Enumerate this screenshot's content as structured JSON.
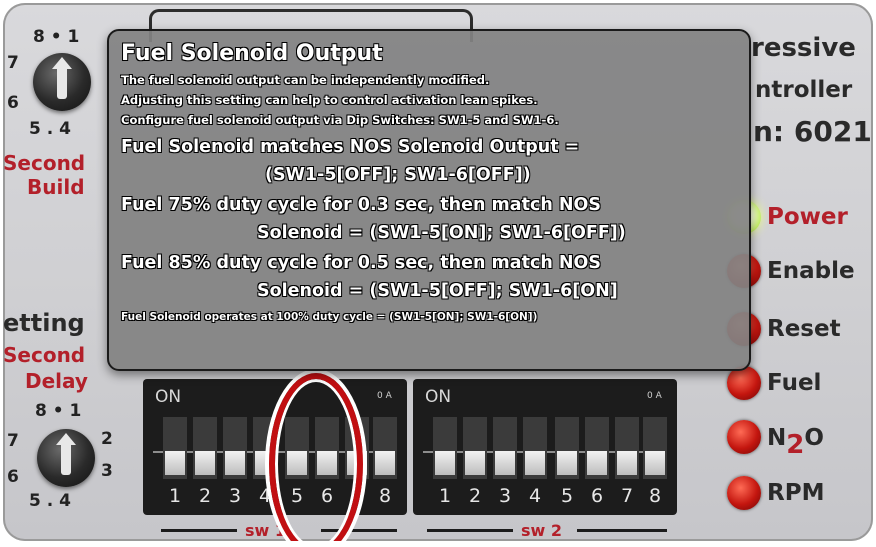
{
  "background": {
    "top_right_lines": [
      "ressive",
      "ntroller",
      "n: 6021"
    ],
    "left_labels": {
      "second_build_1": "Second",
      "second_build_2": "Build",
      "setting": "etting",
      "second_delay_1": "Second",
      "second_delay_2": "Delay"
    },
    "dial_numbers": {
      "top": "8 • 1",
      "left7": "7",
      "left6": "6",
      "bottom": "5 . 4",
      "right2": "2",
      "right3": "3"
    },
    "leds": [
      {
        "label": "Power",
        "state": "on",
        "label_color": "#b3202a"
      },
      {
        "label": "Enable",
        "state": "off",
        "label_color": "#2a2a2a"
      },
      {
        "label": "Reset",
        "state": "off",
        "label_color": "#2a2a2a"
      },
      {
        "label": "Fuel",
        "state": "off",
        "label_color": "#2a2a2a"
      },
      {
        "label": "N2O",
        "state": "off",
        "label_color": "#2a2a2a"
      },
      {
        "label": "RPM",
        "state": "off",
        "label_color": "#2a2a2a"
      }
    ],
    "n2o": {
      "n": "N",
      "sub": "2",
      "o": "O"
    },
    "dip_switch_banks": [
      {
        "on_label": "ON",
        "tiny_label": "0 A",
        "caption": "sw 1",
        "numbers": [
          "1",
          "2",
          "3",
          "4",
          "5",
          "6",
          "7",
          "8"
        ]
      },
      {
        "on_label": "ON",
        "tiny_label": "0 A",
        "caption": "sw 2",
        "numbers": [
          "1",
          "2",
          "3",
          "4",
          "5",
          "6",
          "7",
          "8"
        ]
      }
    ]
  },
  "tooltip": {
    "title": "Fuel Solenoid Output",
    "intro_lines": [
      "The fuel solenoid output can be independently modified.",
      "Adjusting this setting can help to control activation lean spikes.",
      "Configure fuel solenoid output via Dip Switches: SW1-5 and SW1-6."
    ],
    "options": [
      {
        "line1": "Fuel Solenoid matches NOS Solenoid Output =",
        "line2": "(SW1-5[OFF];  SW1-6[OFF])"
      },
      {
        "line1": "Fuel 75% duty cycle for 0.3 sec, then match NOS",
        "line2": "Solenoid = (SW1-5[ON];  SW1-6[OFF])"
      },
      {
        "line1": "Fuel 85% duty cycle for 0.5 sec, then match NOS",
        "line2": "Solenoid = (SW1-5[OFF];  SW1-6[ON]"
      }
    ],
    "footer": "Fuel Solenoid operates at 100% duty cycle = (SW1-5[ON];  SW1-6[ON])"
  },
  "colors": {
    "accent_red": "#c10f12",
    "label_red": "#b3202a",
    "tooltip_bg": "#828282"
  }
}
